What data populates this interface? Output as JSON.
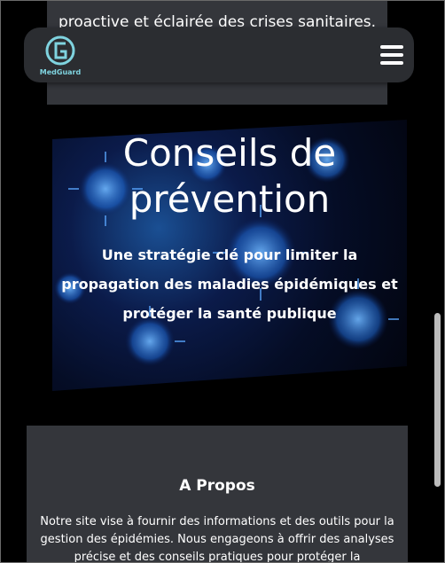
{
  "top_section": {
    "text": "proactive et éclairée des crises sanitaires."
  },
  "header": {
    "logo_text": "MedGuard",
    "menu_label": ""
  },
  "hero": {
    "title": "Conseils de prévention",
    "subtitle": "Une stratégie clé pour limiter la propagation des maladies épidémiques et protéger la santé publique"
  },
  "about": {
    "title": "A Propos",
    "text": "Notre site vise à fournir des informations et des outils pour la gestion des épidémies. Nous engageons à offrir des analyses précise et des conseils pratiques pour protéger la"
  },
  "colors": {
    "background": "#000000",
    "card": "#34363b",
    "header": "#2b2d31",
    "logo_accent": "#7fd3df",
    "hero_blue": "#1a4f93"
  },
  "icons": {
    "logo": "medguard-logo-icon",
    "menu": "hamburger-menu-icon"
  }
}
